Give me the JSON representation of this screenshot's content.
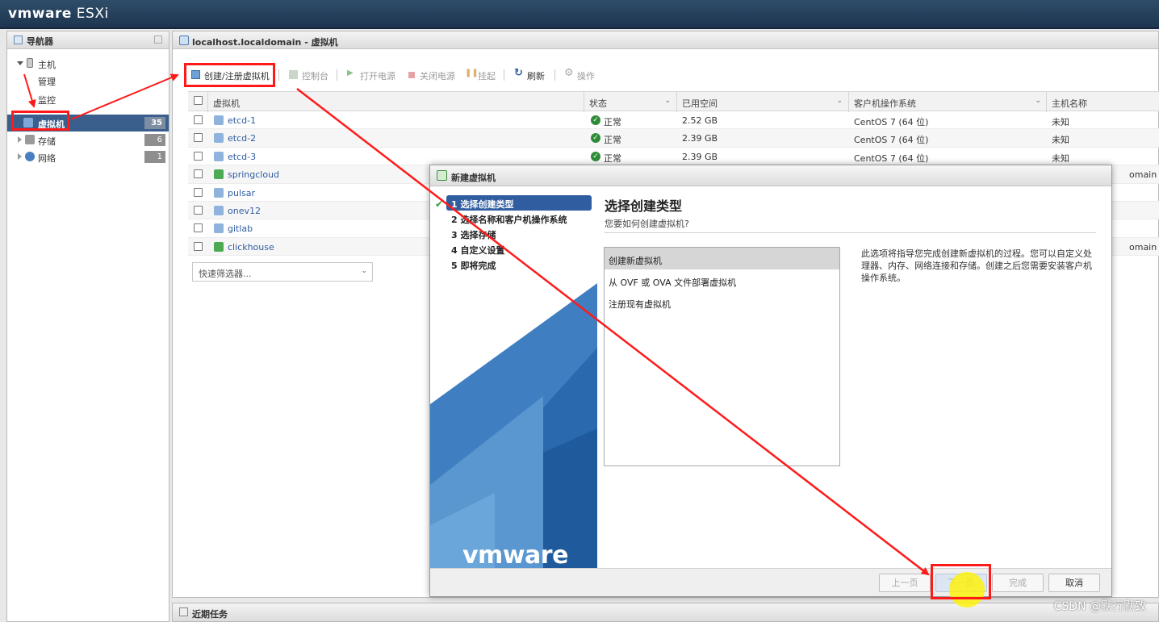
{
  "app": {
    "brand": "vmware",
    "product": "ESXi"
  },
  "navigator": {
    "title": "导航器",
    "host": "主机",
    "manage": "管理",
    "monitor": "监控",
    "items": [
      {
        "label": "虚拟机",
        "count": "35",
        "icon": "vm-icon"
      },
      {
        "label": "存储",
        "count": "6",
        "icon": "storage-icon"
      },
      {
        "label": "网络",
        "count": "1",
        "icon": "network-icon"
      }
    ]
  },
  "main": {
    "title": "localhost.localdomain - 虚拟机",
    "toolbar": {
      "create": "创建/注册虚拟机",
      "console": "控制台",
      "power_on": "打开电源",
      "power_off": "关闭电源",
      "suspend": "挂起",
      "refresh": "刷新",
      "actions": "操作"
    },
    "columns": [
      "虚拟机",
      "状态",
      "已用空间",
      "客户机操作系统",
      "主机名称"
    ],
    "rows": [
      {
        "name": "etcd-1",
        "status": "正常",
        "space": "2.52 GB",
        "os": "CentOS 7 (64 位)",
        "host": "未知"
      },
      {
        "name": "etcd-2",
        "status": "正常",
        "space": "2.39 GB",
        "os": "CentOS 7 (64 位)",
        "host": "未知"
      },
      {
        "name": "etcd-3",
        "status": "正常",
        "space": "2.39 GB",
        "os": "CentOS 7 (64 位)",
        "host": "未知"
      },
      {
        "name": "springcloud",
        "host_partial": "omain"
      },
      {
        "name": "pulsar"
      },
      {
        "name": "onev12"
      },
      {
        "name": "gitlab"
      },
      {
        "name": "clickhouse",
        "host_partial": "omain"
      }
    ],
    "filter_placeholder": "快速筛选器..."
  },
  "recent_tasks": "近期任务",
  "wizard": {
    "title": "新建虚拟机",
    "steps": [
      "1 选择创建类型",
      "2 选择名称和客户机操作系统",
      "3 选择存储",
      "4 自定义设置",
      "5 即将完成"
    ],
    "active_step": 0,
    "heading": "选择创建类型",
    "question": "您要如何创建虚拟机?",
    "options": [
      "创建新虚拟机",
      "从 OVF 或 OVA 文件部署虚拟机",
      "注册现有虚拟机"
    ],
    "selected_option": 0,
    "description": "此选项将指导您完成创建新虚拟机的过程。您可以自定义处理器、内存、网络连接和存储。创建之后您需要安装客户机操作系统。",
    "logo": "vmware",
    "buttons": {
      "back": "上一页",
      "next": "下一页",
      "finish": "完成",
      "cancel": "取消"
    }
  },
  "watermark": "CSDN @默行默致",
  "colors": {
    "accent": "#2f5da0",
    "annotation": "#ff1a1a",
    "ok": "#2e8b38"
  }
}
